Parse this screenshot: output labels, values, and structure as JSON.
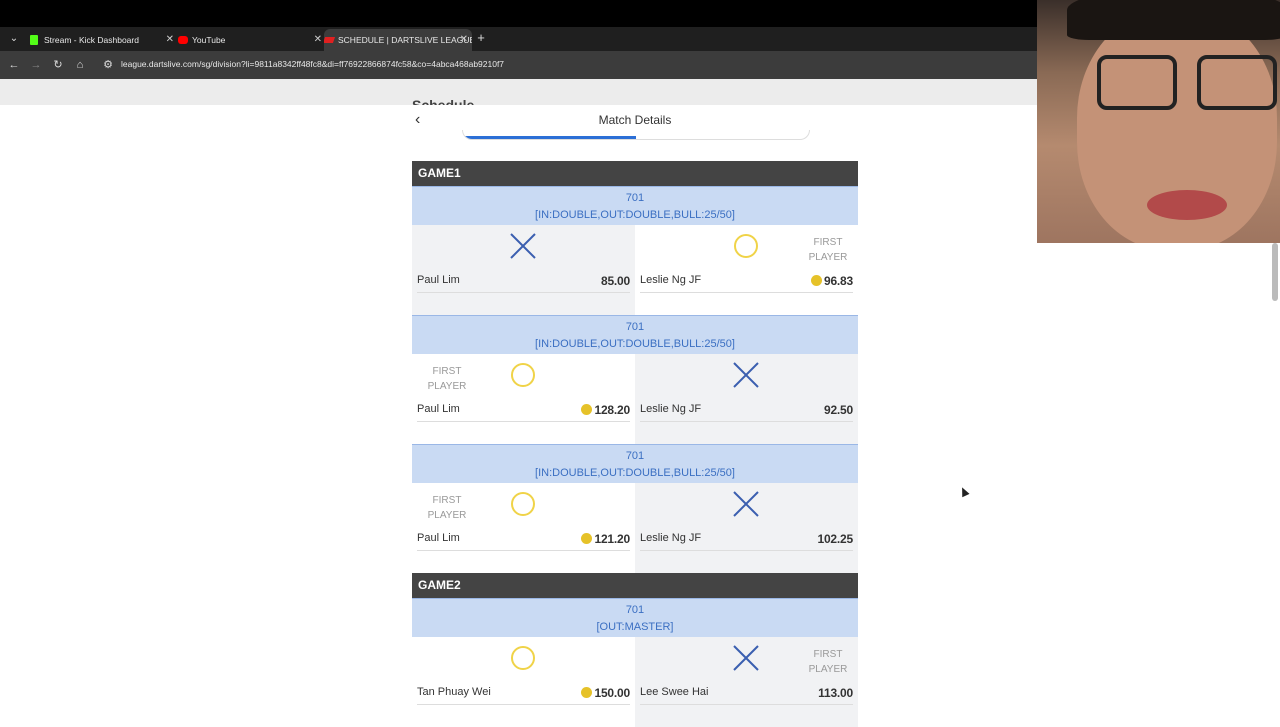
{
  "browser": {
    "tabs": [
      {
        "title": "Stream - Kick Dashboard",
        "icon": "kick-icon",
        "color": "#53fc18"
      },
      {
        "title": "YouTube",
        "icon": "youtube-icon",
        "color": "#ff0000"
      },
      {
        "title": "SCHEDULE | DARTSLIVE LEAGUE",
        "icon": "dartslive-icon",
        "color": "#e02020"
      }
    ],
    "url": "league.dartslive.com/sg/division?li=9811a8342ff48fc8&di=ff76922866874fc58&co=4abca468ab9210f7"
  },
  "page": {
    "background_peek": "Schedule",
    "modal_title": "Match Details"
  },
  "games": [
    {
      "title": "GAME1",
      "legs": [
        {
          "format": "701",
          "rule": "[IN:DOUBLE,OUT:DOUBLE,BULL:25/50]",
          "left": {
            "name": "Paul Lim",
            "score": "85.00",
            "result": "lose",
            "first": false,
            "coin": false
          },
          "right": {
            "name": "Leslie Ng JF",
            "score": "96.83",
            "result": "win",
            "first": true,
            "coin": true
          }
        },
        {
          "format": "701",
          "rule": "[IN:DOUBLE,OUT:DOUBLE,BULL:25/50]",
          "left": {
            "name": "Paul Lim",
            "score": "128.20",
            "result": "win",
            "first": true,
            "coin": true
          },
          "right": {
            "name": "Leslie Ng JF",
            "score": "92.50",
            "result": "lose",
            "first": false,
            "coin": false
          }
        },
        {
          "format": "701",
          "rule": "[IN:DOUBLE,OUT:DOUBLE,BULL:25/50]",
          "left": {
            "name": "Paul Lim",
            "score": "121.20",
            "result": "win",
            "first": true,
            "coin": true
          },
          "right": {
            "name": "Leslie Ng JF",
            "score": "102.25",
            "result": "lose",
            "first": false,
            "coin": false
          }
        }
      ]
    },
    {
      "title": "GAME2",
      "legs": [
        {
          "format": "701",
          "rule": "[OUT:MASTER]",
          "left": {
            "name": "Tan Phuay Wei",
            "score": "150.00",
            "result": "win",
            "first": false,
            "coin": true
          },
          "right": {
            "name": "Lee Swee Hai",
            "score": "113.00",
            "result": "lose",
            "first": true,
            "coin": false
          }
        }
      ]
    }
  ],
  "labels": {
    "first_player_line1": "FIRST",
    "first_player_line2": "PLAYER"
  },
  "colors": {
    "win_mark": "#f0d348",
    "lose_mark": "#3b5fb0",
    "header_bg": "#444444",
    "leg_bg": "#c9daf3"
  }
}
